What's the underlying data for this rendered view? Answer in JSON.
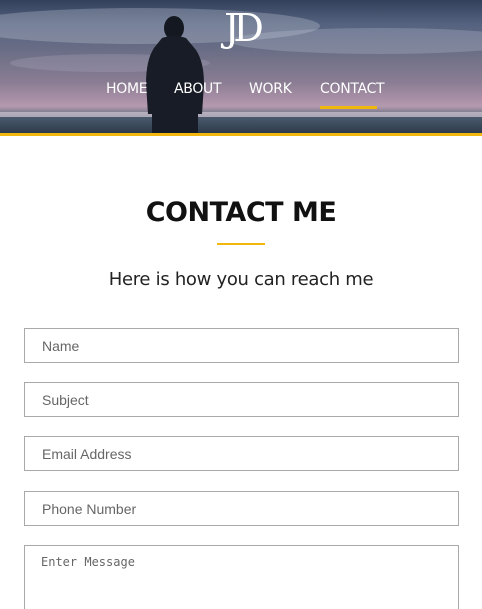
{
  "header": {
    "logo_text": "JD",
    "accent_color": "#f1b70f"
  },
  "nav": {
    "items": [
      {
        "label": "HOME"
      },
      {
        "label": "ABOUT"
      },
      {
        "label": "WORK"
      },
      {
        "label": "CONTACT",
        "active": true
      }
    ]
  },
  "main": {
    "title": "CONTACT ME",
    "subtitle": "Here is how you can reach me"
  },
  "form": {
    "name_placeholder": "Name",
    "subject_placeholder": "Subject",
    "email_placeholder": "Email Address",
    "phone_placeholder": "Phone Number",
    "message_placeholder": "Enter Message"
  }
}
